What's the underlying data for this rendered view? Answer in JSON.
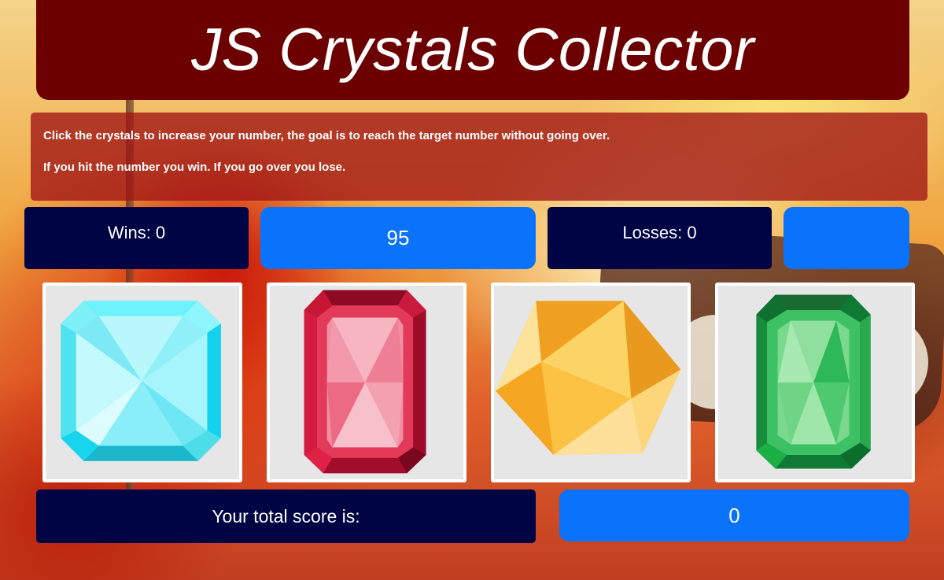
{
  "app": {
    "title": "JS Crystals Collector"
  },
  "instructions": {
    "line1": "Click the crystals to increase your number, the goal is to reach the target number without going over.",
    "line2": "If you hit the number you win. If you go over you lose."
  },
  "stats": {
    "wins_label": "Wins: 0",
    "target_number": "95",
    "losses_label": "Losses: 0"
  },
  "crystals": [
    {
      "icon": "cyan-crystal-icon",
      "color": "#5be8f5"
    },
    {
      "icon": "red-crystal-icon",
      "color": "#d61b3c"
    },
    {
      "icon": "yellow-crystal-icon",
      "color": "#f7b733"
    },
    {
      "icon": "green-crystal-icon",
      "color": "#1fb84a"
    }
  ],
  "score": {
    "label": "Your total score is:",
    "value": "0"
  },
  "colors": {
    "header": "#6c0000",
    "navy": "#000444",
    "accent_blue": "#0a72fb"
  }
}
